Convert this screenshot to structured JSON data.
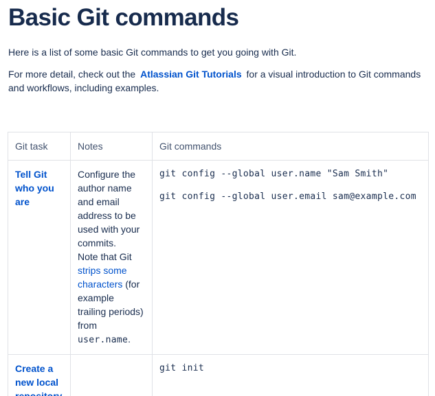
{
  "page": {
    "title": "Basic Git commands",
    "intro": "Here is a list of some basic Git commands to get you going with Git.",
    "detail_before": "For more detail, check out the",
    "detail_link": "Atlassian Git Tutorials",
    "detail_after": "for a visual introduction to Git commands and workflows, including examples."
  },
  "table": {
    "headers": [
      "Git task",
      "Notes",
      "Git commands"
    ],
    "rows": [
      {
        "task": "Tell Git who you are",
        "notes_text_1": "Configure the author name and email address to be used with your commits.",
        "notes_text_2": "Note that Git",
        "notes_link": "strips some characters",
        "notes_text_3": "(for example trailing periods) from",
        "notes_code": "user.name",
        "notes_text_4": ".",
        "commands": [
          "git config --global user.name \"Sam Smith\"",
          "git config --global user.email sam@example.com"
        ]
      },
      {
        "task": "Create a new local repository",
        "notes": "",
        "commands": [
          "git init"
        ]
      }
    ]
  }
}
